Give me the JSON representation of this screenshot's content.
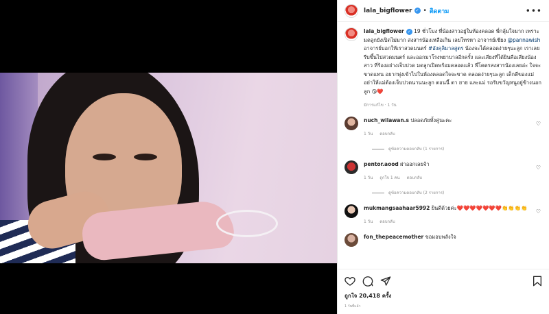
{
  "post": {
    "username": "lala_bigflower",
    "follow_label": "ติดตาม",
    "caption": {
      "username": "lala_bigflower",
      "part1": " 19 ชั่วโมง ที่น้องสาวอยู่ในห้องคลอด พี่กลุ้มใจมาก เพราะมดลูกยังเปิดไม่มาก สงสารน้องเหลือเกิน เลยโทรหา อาจารย์เชียง ",
      "mention": "@pannawish",
      "part2": " อาจารย์บอกให้เราสวดมนตร์ ",
      "hashtag": "#อังคุลิมาลสูตร",
      "part3": " น้องจะได้คลอดง่ายๆนะลูก เราเลยรีบขึ้นไปสวดมนตร์ และออกมาโรงพยาบาลอีกครั้ง และเสียงที่ได้ยินคือเสียงน้องสาว ที่ร้องอย่างเจ็บปวด มดลูกเปิดพร้อมคลอดแล้ว พี่โคตรสงสารน้องเลยอ่ะ ใจจะขาดแทน อยากพุ่งเข้าไปในห้องคลอดใจจะขาด คลอดง่ายๆนะลูก เด็กดีของแม่ อย่าให้แม่ต้องเจ็บปวดนานนะลูก ตอนนี้ ตา ยาย และแม่ รอรับขวัญหนูอยู่ข้างนอกลูก 😘❤️"
    },
    "caption_meta": "มีการแก้ไข · 1 วัน",
    "comments": [
      {
        "username": "nuch_wilawan.s",
        "text": "ปลอดภัยทั้งคู่นะคะ",
        "time": "1 วัน",
        "likes": "",
        "reply": "ตอบกลับ",
        "view_replies": "ดูข้อความตอบกลับ (1 รายการ)"
      },
      {
        "username": "pentor.aood",
        "text": "ผ่าออกเลยจ้า",
        "time": "1 วัน",
        "likes": "ถูกใจ 1 คน",
        "reply": "ตอบกลับ",
        "view_replies": "ดูข้อความตอบกลับ (2 รายการ)"
      },
      {
        "username": "mukmangsaahaar5992",
        "text": "ยินดีด้วยค่ะ❤️❤️❤️❤️❤️❤️❤️👏👏👏👏",
        "time": "1 วัน",
        "likes": "",
        "reply": "ตอบกลับ",
        "view_replies": ""
      },
      {
        "username": "fon_thepeacemother",
        "text": "ขอมอบพลังใจ",
        "time": "",
        "likes": "",
        "reply": "",
        "view_replies": ""
      }
    ],
    "likes_label": "ถูกใจ 20,418 ครั้ง",
    "posted_ago": "1 วันที่แล้ว"
  },
  "colors": {
    "accent": "#0095f6",
    "verified": "#3897f0",
    "text": "#262626",
    "muted": "#8e8e8e"
  }
}
